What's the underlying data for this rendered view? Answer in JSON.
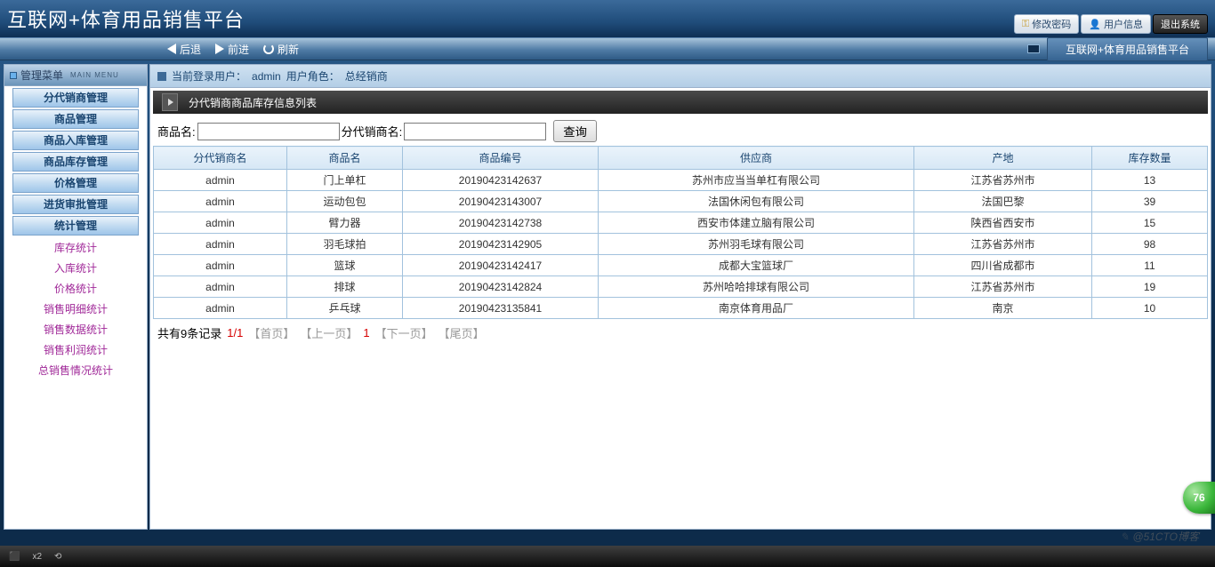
{
  "banner": {
    "title": "互联网+体育用品销售平台"
  },
  "top_buttons": {
    "change_pw": "修改密码",
    "user_info": "用户信息",
    "logout": "退出系统"
  },
  "nav": {
    "back": "后退",
    "forward": "前进",
    "refresh": "刷新",
    "platform_tab": "互联网+体育用品销售平台"
  },
  "sidebar": {
    "header": "管理菜单",
    "header_sub": "MAIN MENU",
    "items": [
      {
        "label": "分代销商管理"
      },
      {
        "label": "商品管理"
      },
      {
        "label": "商品入库管理"
      },
      {
        "label": "商品库存管理"
      },
      {
        "label": "价格管理"
      },
      {
        "label": "进货审批管理"
      },
      {
        "label": "统计管理"
      }
    ],
    "sub_items": [
      {
        "label": "库存统计"
      },
      {
        "label": "入库统计"
      },
      {
        "label": "价格统计"
      },
      {
        "label": "销售明细统计"
      },
      {
        "label": "销售数据统计"
      },
      {
        "label": "销售利润统计"
      },
      {
        "label": "总销售情况统计"
      }
    ]
  },
  "login_bar": {
    "prefix": "当前登录用户：",
    "user": "admin",
    "role_prefix": "用户角色：",
    "role": "总经销商"
  },
  "panel": {
    "title": "分代销商商品库存信息列表",
    "label_product": "商品名:",
    "label_dealer": "分代销商名:",
    "btn_search": "查询"
  },
  "table": {
    "headers": [
      "分代销商名",
      "商品名",
      "商品编号",
      "供应商",
      "产地",
      "库存数量"
    ],
    "rows": [
      [
        "admin",
        "门上单杠",
        "20190423142637",
        "苏州市应当当单杠有限公司",
        "江苏省苏州市",
        "13"
      ],
      [
        "admin",
        "运动包包",
        "20190423143007",
        "法国休闲包有限公司",
        "法国巴黎",
        "39"
      ],
      [
        "admin",
        "臂力器",
        "20190423142738",
        "西安市体建立脑有限公司",
        "陕西省西安市",
        "15"
      ],
      [
        "admin",
        "羽毛球拍",
        "20190423142905",
        "苏州羽毛球有限公司",
        "江苏省苏州市",
        "98"
      ],
      [
        "admin",
        "篮球",
        "20190423142417",
        "成都大宝篮球厂",
        "四川省成都市",
        "11"
      ],
      [
        "admin",
        "排球",
        "20190423142824",
        "苏州哈哈排球有限公司",
        "江苏省苏州市",
        "19"
      ],
      [
        "admin",
        "乒乓球",
        "20190423135841",
        "南京体育用品厂",
        "南京",
        "10"
      ]
    ]
  },
  "pager": {
    "total": "共有9条记录",
    "page": "1/1",
    "first": "【首页】",
    "prev": "【上一页】",
    "current": "1",
    "next": "【下一页】",
    "last": "【尾页】"
  },
  "bubble": "76",
  "watermark": "@51CTO博客",
  "footer": {
    "x2": "x2"
  }
}
